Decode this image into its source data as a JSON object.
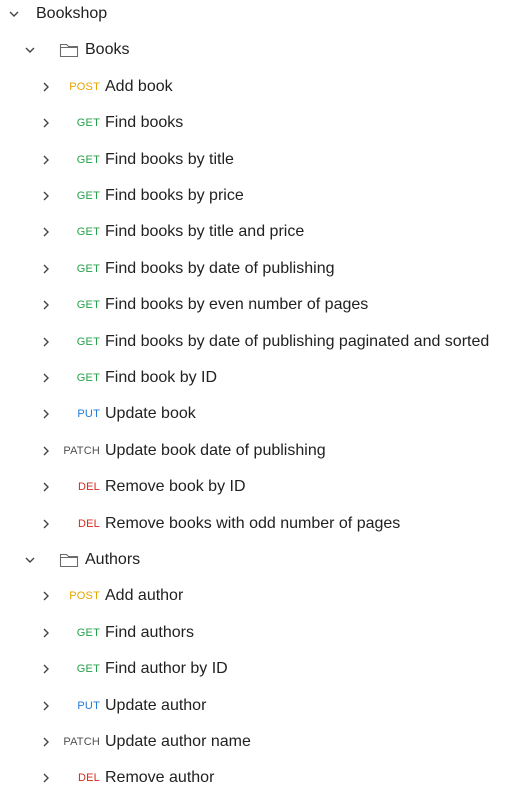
{
  "colors": {
    "POST": "#e6a400",
    "GET": "#24a148",
    "PUT": "#1f7ad6",
    "PATCH": "#505050",
    "DEL": "#d9281b"
  },
  "collection": {
    "name": "Bookshop",
    "expanded": true,
    "folders": [
      {
        "name": "Books",
        "expanded": true,
        "requests": [
          {
            "method": "POST",
            "name": "Add book"
          },
          {
            "method": "GET",
            "name": "Find books"
          },
          {
            "method": "GET",
            "name": "Find books by title"
          },
          {
            "method": "GET",
            "name": "Find books by price"
          },
          {
            "method": "GET",
            "name": "Find books by title and price"
          },
          {
            "method": "GET",
            "name": "Find books by date of publishing"
          },
          {
            "method": "GET",
            "name": "Find books by even number of pages"
          },
          {
            "method": "GET",
            "name": "Find books by date of publishing paginated and sorted"
          },
          {
            "method": "GET",
            "name": "Find book by ID"
          },
          {
            "method": "PUT",
            "name": "Update book"
          },
          {
            "method": "PATCH",
            "name": "Update book date of publishing"
          },
          {
            "method": "DEL",
            "name": "Remove book by ID"
          },
          {
            "method": "DEL",
            "name": "Remove books with odd number of pages"
          }
        ]
      },
      {
        "name": "Authors",
        "expanded": true,
        "requests": [
          {
            "method": "POST",
            "name": "Add author"
          },
          {
            "method": "GET",
            "name": "Find authors"
          },
          {
            "method": "GET",
            "name": "Find author by ID"
          },
          {
            "method": "PUT",
            "name": "Update author"
          },
          {
            "method": "PATCH",
            "name": "Update author name"
          },
          {
            "method": "DEL",
            "name": "Remove author"
          }
        ]
      }
    ]
  }
}
